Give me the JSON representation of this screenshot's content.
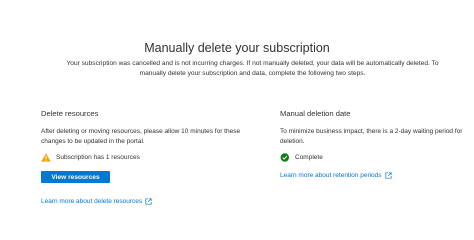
{
  "header": {
    "title": "Manually delete your subscription",
    "description": "Your subscription was cancelled and is not incurring charges. If not manually deleted, your data will be automatically deleted. To manually delete your subscription and data, complete the following two steps."
  },
  "delete_resources": {
    "title": "Delete resources",
    "text": "After deleting or moving resources, please allow 10 minutes for these changes to be updated in the portal.",
    "status": "Subscription has 1 resources",
    "status_icon": "warning-icon",
    "button_label": "View resources",
    "link_label": "Learn more about delete resources"
  },
  "manual_deletion_date": {
    "title": "Manual deletion date",
    "text": "To minimize business impact, there is a 2-day waiting period for deletion.",
    "status": "Complete",
    "status_icon": "check-circle-icon",
    "link_label": "Learn more about retention periods"
  },
  "colors": {
    "accent": "#0078d4",
    "warning": "#f2a100",
    "success": "#107c10",
    "text": "#323130"
  }
}
